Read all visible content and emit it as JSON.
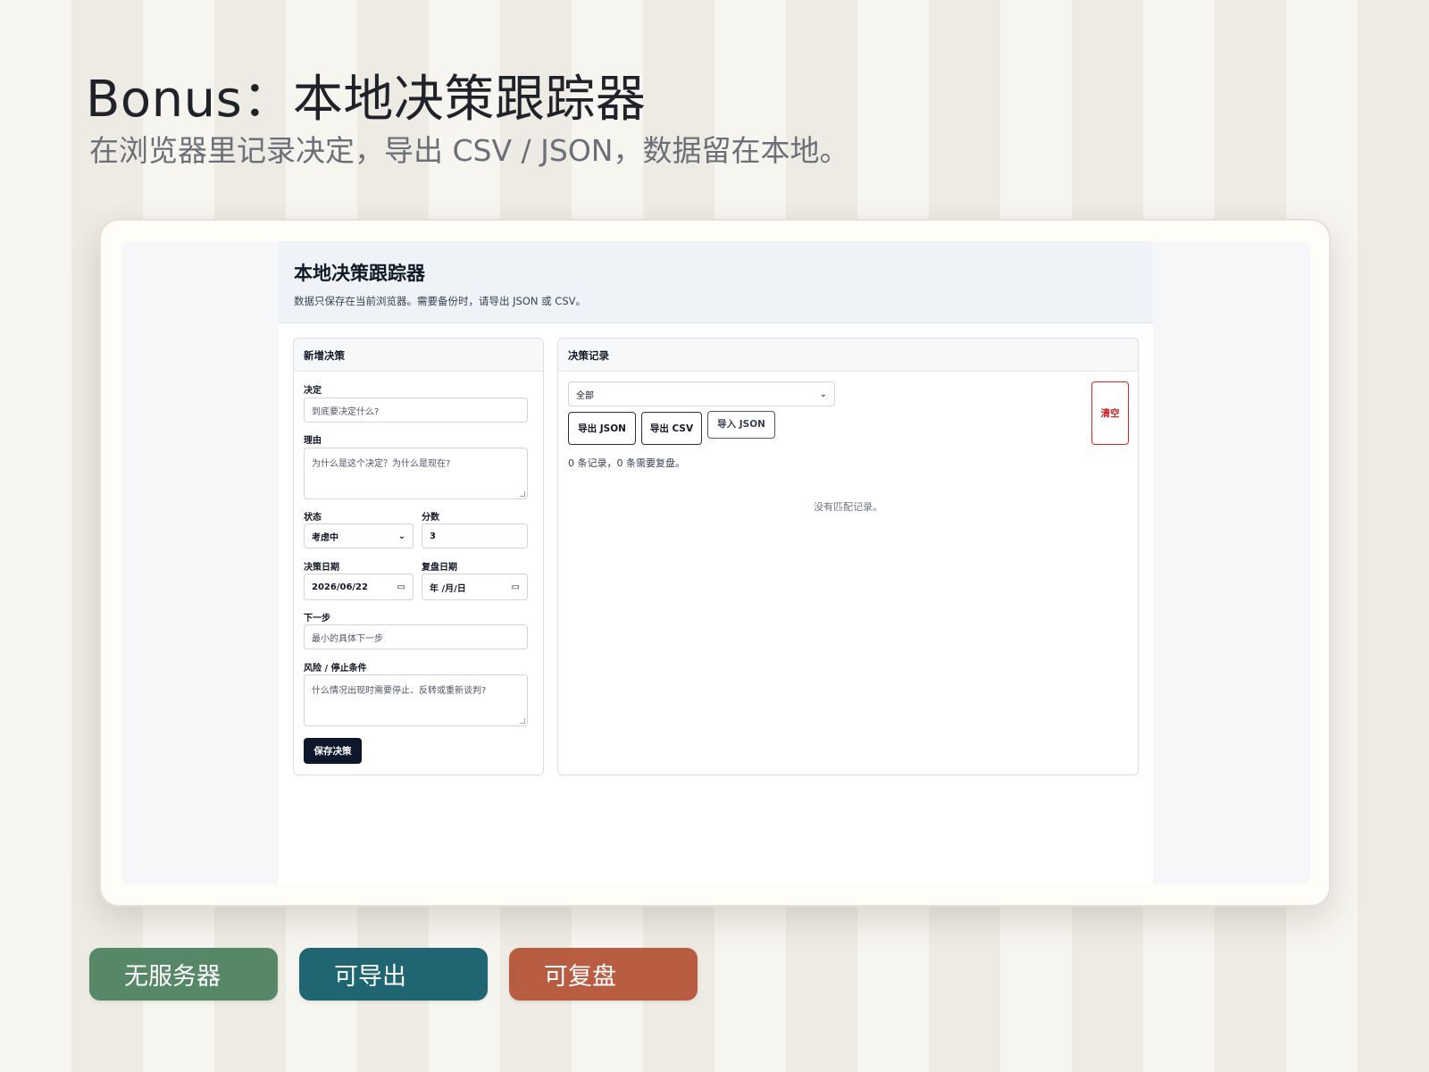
{
  "slide": {
    "title": "Bonus：本地决策跟踪器",
    "subtitle": "在浏览器里记录决定，导出 CSV / JSON，数据留在本地。"
  },
  "app": {
    "title": "本地决策跟踪器",
    "description": "数据只保存在当前浏览器。需要备份时，请导出 JSON 或 CSV。"
  },
  "form": {
    "heading": "新增决策",
    "decision_label": "决定",
    "decision_placeholder": "到底要决定什么?",
    "reason_label": "理由",
    "reason_placeholder": "为什么是这个决定？为什么是现在?",
    "status_label": "状态",
    "status_value": "考虑中",
    "score_label": "分数",
    "score_value": "3",
    "decision_date_label": "决策日期",
    "decision_date_value": "2026/06/22",
    "review_date_label": "复盘日期",
    "review_date_value": "年 /月/日",
    "next_step_label": "下一步",
    "next_step_placeholder": "最小的具体下一步",
    "risk_label": "风险 / 停止条件",
    "risk_placeholder": "什么情况出现时需要停止、反转或重新谈判?",
    "save_label": "保存决策"
  },
  "records": {
    "heading": "决策记录",
    "filter_value": "全部",
    "export_json_label": "导出 JSON",
    "export_csv_label": "导出 CSV",
    "import_json_label": "导入 JSON",
    "clear_label": "清空",
    "count_text": "0 条记录，0 条需要复盘。",
    "empty_text": "没有匹配记录。"
  },
  "tags": [
    {
      "label": "无服务器",
      "color": "#568868"
    },
    {
      "label": "可导出",
      "color": "#1f6672"
    },
    {
      "label": "可复盘",
      "color": "#b85d42"
    }
  ]
}
